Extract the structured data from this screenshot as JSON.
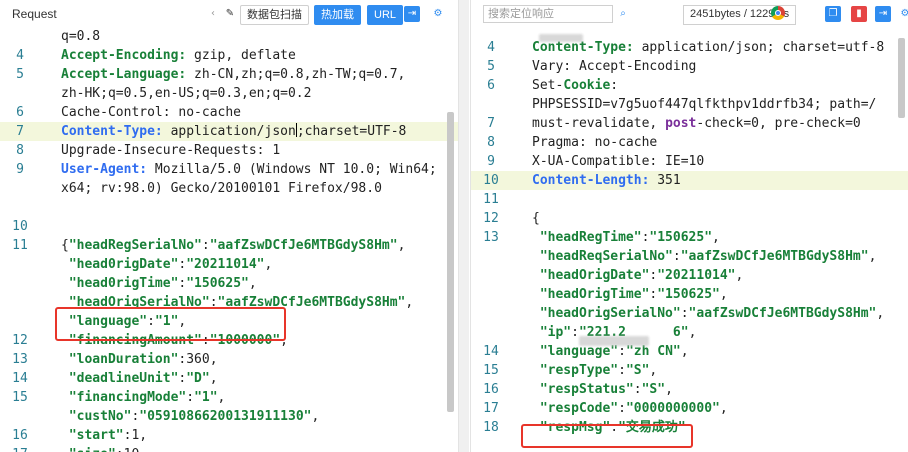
{
  "left": {
    "title": "Request",
    "buttons": [
      "数据包扫描",
      "热加载",
      "URL"
    ],
    "lines": [
      {
        "n": "",
        "parts": [
          [
            "t",
            "q=0.8"
          ]
        ]
      },
      {
        "n": "4",
        "parts": [
          [
            "k",
            "Accept-Encoding:"
          ],
          [
            "t",
            " gzip, deflate"
          ]
        ]
      },
      {
        "n": "5",
        "parts": [
          [
            "k",
            "Accept-Language:"
          ],
          [
            "t",
            " zh-CN,zh;q=0.8,zh-TW;q=0.7,"
          ]
        ]
      },
      {
        "n": "",
        "parts": [
          [
            "t",
            "zh-HK;q=0.5,en-US;q=0.3,en;q=0.2"
          ]
        ]
      },
      {
        "n": "6",
        "parts": [
          [
            "t",
            "Cache-Control: no-cache"
          ]
        ]
      },
      {
        "n": "7",
        "parts": [
          [
            "k2",
            "Content-Type:"
          ],
          [
            "t",
            " application/json"
          ],
          [
            "c",
            ""
          ],
          [
            "t",
            ";charset=UTF-8"
          ]
        ],
        "hl": true
      },
      {
        "n": "8",
        "parts": [
          [
            "t",
            "Upgrade-Insecure-Requests: 1"
          ]
        ]
      },
      {
        "n": "9",
        "parts": [
          [
            "k2",
            "User-Agent:"
          ],
          [
            "t",
            " Mozilla/5.0 (Windows NT 10.0; Win64;"
          ]
        ]
      },
      {
        "n": "",
        "parts": [
          [
            "t",
            "x64; rv:98.0) Gecko/20100101 Firefox/98.0"
          ]
        ]
      },
      {
        "n": "",
        "parts": []
      },
      {
        "n": "10",
        "parts": []
      },
      {
        "n": "11",
        "parts": [
          [
            "t",
            "{"
          ],
          [
            "s",
            "\"headRegSerialNo\""
          ],
          [
            "t",
            ":"
          ],
          [
            "s",
            "\"aafZswDCfJe6MTBGdyS8Hm\""
          ],
          [
            "t",
            ","
          ]
        ]
      },
      {
        "n": "",
        "parts": [
          [
            "t",
            " "
          ],
          [
            "s",
            "\"head0rigDate\""
          ],
          [
            "t",
            ":"
          ],
          [
            "s",
            "\"20211014\""
          ],
          [
            "t",
            ","
          ]
        ]
      },
      {
        "n": "",
        "parts": [
          [
            "t",
            " "
          ],
          [
            "s",
            "\"head0rigTime\""
          ],
          [
            "t",
            ":"
          ],
          [
            "s",
            "\"150625\""
          ],
          [
            "t",
            ","
          ]
        ]
      },
      {
        "n": "",
        "parts": [
          [
            "t",
            " "
          ],
          [
            "s",
            "\"headOrigSerialNo\""
          ],
          [
            "t",
            ":"
          ],
          [
            "s",
            "\"aafZswDCfJe6MTBGdyS8Hm\""
          ],
          [
            "t",
            ","
          ]
        ]
      },
      {
        "n": "",
        "parts": [
          [
            "t",
            " "
          ],
          [
            "s",
            "\"language\""
          ],
          [
            "t",
            ":"
          ],
          [
            "s",
            "\"1\""
          ],
          [
            "t",
            ","
          ]
        ]
      },
      {
        "n": "12",
        "parts": [
          [
            "t",
            " "
          ],
          [
            "s",
            "\"financingAmount\""
          ],
          [
            "t",
            ":"
          ],
          [
            "s",
            "\"1000000\""
          ],
          [
            "t",
            ","
          ]
        ]
      },
      {
        "n": "13",
        "parts": [
          [
            "t",
            " "
          ],
          [
            "s",
            "\"loanDuration\""
          ],
          [
            "t",
            ":360,"
          ]
        ]
      },
      {
        "n": "14",
        "parts": [
          [
            "t",
            " "
          ],
          [
            "s",
            "\"deadlineUnit\""
          ],
          [
            "t",
            ":"
          ],
          [
            "s",
            "\"D\""
          ],
          [
            "t",
            ","
          ]
        ]
      },
      {
        "n": "15",
        "parts": [
          [
            "t",
            " "
          ],
          [
            "s",
            "\"financingMode\""
          ],
          [
            "t",
            ":"
          ],
          [
            "s",
            "\"1\""
          ],
          [
            "t",
            ","
          ]
        ]
      },
      {
        "n": "",
        "parts": [
          [
            "t",
            " "
          ],
          [
            "s",
            "\"custNo\""
          ],
          [
            "t",
            ":"
          ],
          [
            "s",
            "\"05910866200131911130\""
          ],
          [
            "t",
            ","
          ]
        ]
      },
      {
        "n": "16",
        "parts": [
          [
            "t",
            " "
          ],
          [
            "s",
            "\"start\""
          ],
          [
            "t",
            ":1,"
          ]
        ]
      },
      {
        "n": "17",
        "parts": [
          [
            "t",
            " "
          ],
          [
            "s",
            "\"size\""
          ],
          [
            "t",
            ":10,"
          ]
        ]
      }
    ]
  },
  "right": {
    "search_placeholder": "搜索定位响应",
    "bytes": "2451bytes / 1229ms",
    "lines": [
      {
        "n": "",
        "parts": []
      },
      {
        "n": "4",
        "parts": [
          [
            "k",
            "Content-Type:"
          ],
          [
            "t",
            " application/json; charset=utf-8"
          ]
        ]
      },
      {
        "n": "5",
        "parts": [
          [
            "t",
            "Vary: Accept-Encoding"
          ]
        ]
      },
      {
        "n": "6",
        "parts": [
          [
            "t",
            "Set-"
          ],
          [
            "k",
            "Cookie"
          ],
          [
            "t",
            ":"
          ]
        ]
      },
      {
        "n": "",
        "parts": [
          [
            "t",
            "PHPSESSID=v7g5uof447qlfkthpv1ddrfb34; path=/"
          ]
        ]
      },
      {
        "n": "7",
        "parts": [
          [
            "t",
            "must-revalidate, "
          ],
          [
            "kw",
            "post"
          ],
          [
            "t",
            "-check=0, pre-check=0"
          ]
        ]
      },
      {
        "n": "8",
        "parts": [
          [
            "t",
            "Pragma: no-cache"
          ]
        ]
      },
      {
        "n": "9",
        "parts": [
          [
            "t",
            "X-UA-Compatible: IE=10"
          ]
        ]
      },
      {
        "n": "10",
        "parts": [
          [
            "k2",
            "Content-Length:"
          ],
          [
            "t",
            " 351"
          ]
        ],
        "hl": true
      },
      {
        "n": "11",
        "parts": []
      },
      {
        "n": "12",
        "parts": [
          [
            "t",
            "{"
          ]
        ]
      },
      {
        "n": "13",
        "parts": [
          [
            "t",
            " "
          ],
          [
            "s",
            "\"headRegTime\""
          ],
          [
            "t",
            ":"
          ],
          [
            "s",
            "\"150625\""
          ],
          [
            "t",
            ","
          ]
        ]
      },
      {
        "n": "",
        "parts": [
          [
            "t",
            " "
          ],
          [
            "s",
            "\"headReqSerialNo\""
          ],
          [
            "t",
            ":"
          ],
          [
            "s",
            "\"aafZswDCfJe6MTBGdyS8Hm\""
          ],
          [
            "t",
            ","
          ]
        ]
      },
      {
        "n": "",
        "parts": [
          [
            "t",
            " "
          ],
          [
            "s",
            "\"headOrigDate\""
          ],
          [
            "t",
            ":"
          ],
          [
            "s",
            "\"20211014\""
          ],
          [
            "t",
            ","
          ]
        ]
      },
      {
        "n": "",
        "parts": [
          [
            "t",
            " "
          ],
          [
            "s",
            "\"headOrigTime\""
          ],
          [
            "t",
            ":"
          ],
          [
            "s",
            "\"150625\""
          ],
          [
            "t",
            ","
          ]
        ]
      },
      {
        "n": "",
        "parts": [
          [
            "t",
            " "
          ],
          [
            "s",
            "\"headOrigSerialNo\""
          ],
          [
            "t",
            ":"
          ],
          [
            "s",
            "\"aafZswDCfJe6MTBGdyS8Hm\""
          ],
          [
            "t",
            ","
          ]
        ]
      },
      {
        "n": "",
        "parts": [
          [
            "t",
            " "
          ],
          [
            "s",
            "\"ip\""
          ],
          [
            "t",
            ":"
          ],
          [
            "s",
            "\"221.2"
          ],
          [
            "t",
            "      "
          ],
          [
            "s",
            "6\""
          ],
          [
            "t",
            ","
          ]
        ]
      },
      {
        "n": "14",
        "parts": [
          [
            "t",
            " "
          ],
          [
            "s",
            "\"language\""
          ],
          [
            "t",
            ":"
          ],
          [
            "s",
            "\"zh CN\""
          ],
          [
            "t",
            ","
          ]
        ]
      },
      {
        "n": "15",
        "parts": [
          [
            "t",
            " "
          ],
          [
            "s",
            "\"respType\""
          ],
          [
            "t",
            ":"
          ],
          [
            "s",
            "\"S\""
          ],
          [
            "t",
            ","
          ]
        ]
      },
      {
        "n": "16",
        "parts": [
          [
            "t",
            " "
          ],
          [
            "s",
            "\"respStatus\""
          ],
          [
            "t",
            ":"
          ],
          [
            "s",
            "\"S\""
          ],
          [
            "t",
            ","
          ]
        ]
      },
      {
        "n": "17",
        "parts": [
          [
            "t",
            " "
          ],
          [
            "s",
            "\"respCode\""
          ],
          [
            "t",
            ":"
          ],
          [
            "s",
            "\"0000000000\""
          ],
          [
            "t",
            ","
          ]
        ]
      },
      {
        "n": "18",
        "parts": [
          [
            "t",
            " "
          ],
          [
            "s",
            "\"respMsg\""
          ],
          [
            "t",
            ":"
          ],
          [
            "s",
            "\"交易成功\""
          ]
        ]
      }
    ]
  }
}
